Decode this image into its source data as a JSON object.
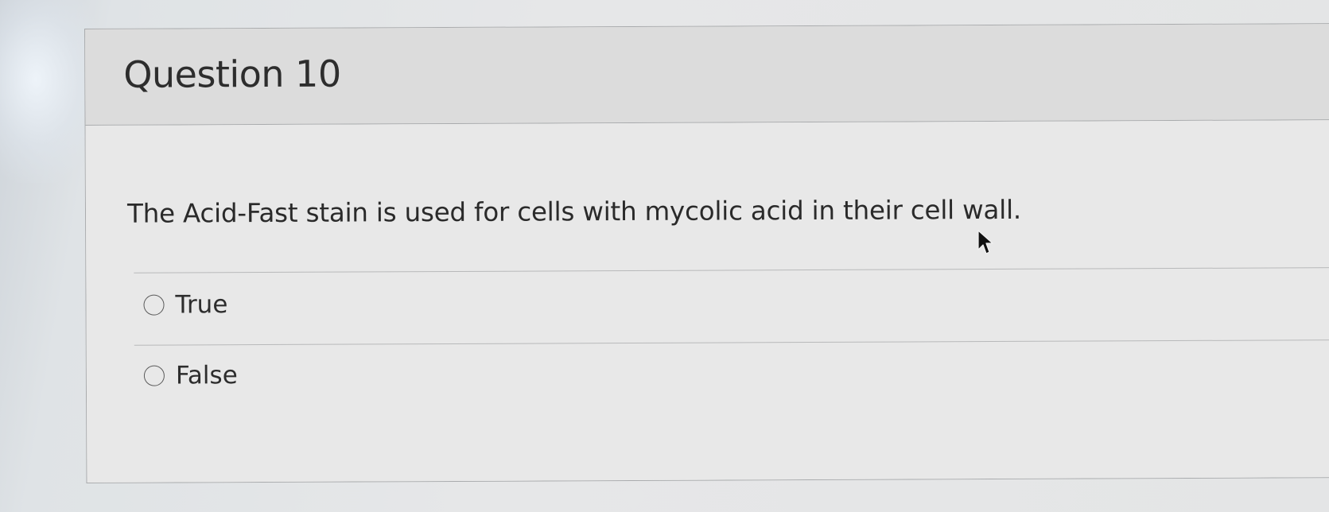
{
  "question": {
    "title": "Question 10",
    "text": "The Acid-Fast stain is used for cells with mycolic acid in their cell wall.",
    "answers": [
      {
        "label": "True",
        "selected": false
      },
      {
        "label": "False",
        "selected": false
      }
    ]
  },
  "cursor_icon": "arrow-pointer-icon",
  "colors": {
    "header_background": "#dcdcdc",
    "body_background": "#e8e8e8",
    "border": "#a9abad",
    "text": "#2d2d2d"
  }
}
